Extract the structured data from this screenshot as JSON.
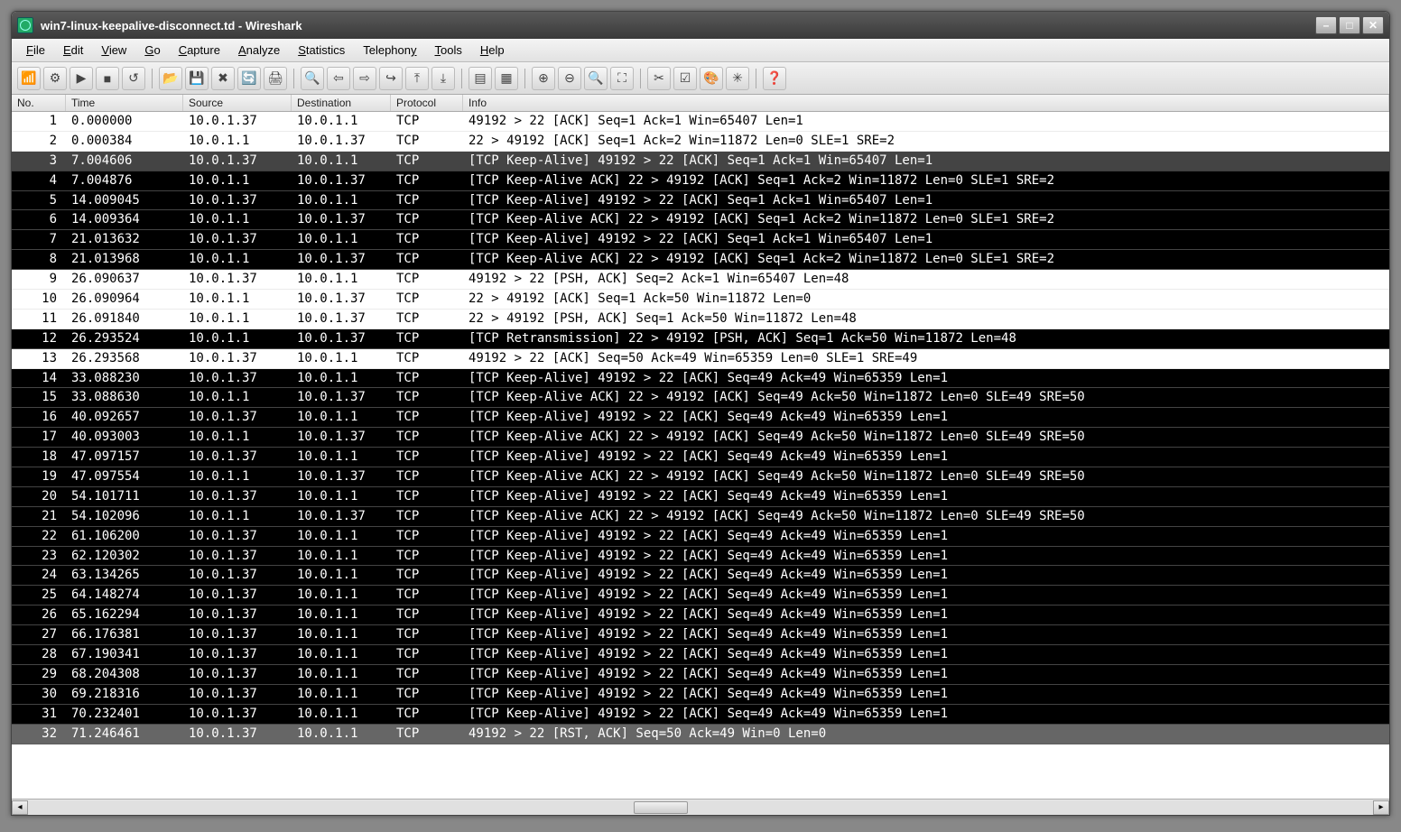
{
  "window": {
    "title": "win7-linux-keepalive-disconnect.td - Wireshark"
  },
  "menu": {
    "file": "File",
    "edit": "Edit",
    "view": "View",
    "go": "Go",
    "capture": "Capture",
    "analyze": "Analyze",
    "statistics": "Statistics",
    "telephony": "Telephony",
    "tools": "Tools",
    "help": "Help"
  },
  "columns": {
    "no": "No.",
    "time": "Time",
    "source": "Source",
    "destination": "Destination",
    "protocol": "Protocol",
    "info": "Info"
  },
  "packets": [
    {
      "no": "1",
      "time": "0.000000",
      "src": "10.0.1.37",
      "dst": "10.0.1.1",
      "proto": "TCP",
      "info": "49192 > 22 [ACK] Seq=1 Ack=1 Win=65407 Len=1",
      "style": "normal"
    },
    {
      "no": "2",
      "time": "0.000384",
      "src": "10.0.1.1",
      "dst": "10.0.1.37",
      "proto": "TCP",
      "info": "22 > 49192 [ACK] Seq=1 Ack=2 Win=11872 Len=0 SLE=1 SRE=2",
      "style": "normal"
    },
    {
      "no": "3",
      "time": "7.004606",
      "src": "10.0.1.37",
      "dst": "10.0.1.1",
      "proto": "TCP",
      "info": "[TCP Keep-Alive] 49192 > 22 [ACK] Seq=1 Ack=1 Win=65407 Len=1",
      "style": "selected"
    },
    {
      "no": "4",
      "time": "7.004876",
      "src": "10.0.1.1",
      "dst": "10.0.1.37",
      "proto": "TCP",
      "info": "[TCP Keep-Alive ACK] 22 > 49192 [ACK] Seq=1 Ack=2 Win=11872 Len=0 SLE=1 SRE=2",
      "style": "dark"
    },
    {
      "no": "5",
      "time": "14.009045",
      "src": "10.0.1.37",
      "dst": "10.0.1.1",
      "proto": "TCP",
      "info": "[TCP Keep-Alive] 49192 > 22 [ACK] Seq=1 Ack=1 Win=65407 Len=1",
      "style": "dark"
    },
    {
      "no": "6",
      "time": "14.009364",
      "src": "10.0.1.1",
      "dst": "10.0.1.37",
      "proto": "TCP",
      "info": "[TCP Keep-Alive ACK] 22 > 49192 [ACK] Seq=1 Ack=2 Win=11872 Len=0 SLE=1 SRE=2",
      "style": "dark"
    },
    {
      "no": "7",
      "time": "21.013632",
      "src": "10.0.1.37",
      "dst": "10.0.1.1",
      "proto": "TCP",
      "info": "[TCP Keep-Alive] 49192 > 22 [ACK] Seq=1 Ack=1 Win=65407 Len=1",
      "style": "dark"
    },
    {
      "no": "8",
      "time": "21.013968",
      "src": "10.0.1.1",
      "dst": "10.0.1.37",
      "proto": "TCP",
      "info": "[TCP Keep-Alive ACK] 22 > 49192 [ACK] Seq=1 Ack=2 Win=11872 Len=0 SLE=1 SRE=2",
      "style": "dark"
    },
    {
      "no": "9",
      "time": "26.090637",
      "src": "10.0.1.37",
      "dst": "10.0.1.1",
      "proto": "TCP",
      "info": "49192 > 22 [PSH, ACK] Seq=2 Ack=1 Win=65407 Len=48",
      "style": "normal"
    },
    {
      "no": "10",
      "time": "26.090964",
      "src": "10.0.1.1",
      "dst": "10.0.1.37",
      "proto": "TCP",
      "info": "22 > 49192 [ACK] Seq=1 Ack=50 Win=11872 Len=0",
      "style": "normal"
    },
    {
      "no": "11",
      "time": "26.091840",
      "src": "10.0.1.1",
      "dst": "10.0.1.37",
      "proto": "TCP",
      "info": "22 > 49192 [PSH, ACK] Seq=1 Ack=50 Win=11872 Len=48",
      "style": "normal"
    },
    {
      "no": "12",
      "time": "26.293524",
      "src": "10.0.1.1",
      "dst": "10.0.1.37",
      "proto": "TCP",
      "info": "[TCP Retransmission] 22 > 49192 [PSH, ACK] Seq=1 Ack=50 Win=11872 Len=48",
      "style": "dark"
    },
    {
      "no": "13",
      "time": "26.293568",
      "src": "10.0.1.37",
      "dst": "10.0.1.1",
      "proto": "TCP",
      "info": "49192 > 22 [ACK] Seq=50 Ack=49 Win=65359 Len=0 SLE=1 SRE=49",
      "style": "normal"
    },
    {
      "no": "14",
      "time": "33.088230",
      "src": "10.0.1.37",
      "dst": "10.0.1.1",
      "proto": "TCP",
      "info": "[TCP Keep-Alive] 49192 > 22 [ACK] Seq=49 Ack=49 Win=65359 Len=1",
      "style": "dark"
    },
    {
      "no": "15",
      "time": "33.088630",
      "src": "10.0.1.1",
      "dst": "10.0.1.37",
      "proto": "TCP",
      "info": "[TCP Keep-Alive ACK] 22 > 49192 [ACK] Seq=49 Ack=50 Win=11872 Len=0 SLE=49 SRE=50",
      "style": "dark"
    },
    {
      "no": "16",
      "time": "40.092657",
      "src": "10.0.1.37",
      "dst": "10.0.1.1",
      "proto": "TCP",
      "info": "[TCP Keep-Alive] 49192 > 22 [ACK] Seq=49 Ack=49 Win=65359 Len=1",
      "style": "dark"
    },
    {
      "no": "17",
      "time": "40.093003",
      "src": "10.0.1.1",
      "dst": "10.0.1.37",
      "proto": "TCP",
      "info": "[TCP Keep-Alive ACK] 22 > 49192 [ACK] Seq=49 Ack=50 Win=11872 Len=0 SLE=49 SRE=50",
      "style": "dark"
    },
    {
      "no": "18",
      "time": "47.097157",
      "src": "10.0.1.37",
      "dst": "10.0.1.1",
      "proto": "TCP",
      "info": "[TCP Keep-Alive] 49192 > 22 [ACK] Seq=49 Ack=49 Win=65359 Len=1",
      "style": "dark"
    },
    {
      "no": "19",
      "time": "47.097554",
      "src": "10.0.1.1",
      "dst": "10.0.1.37",
      "proto": "TCP",
      "info": "[TCP Keep-Alive ACK] 22 > 49192 [ACK] Seq=49 Ack=50 Win=11872 Len=0 SLE=49 SRE=50",
      "style": "dark"
    },
    {
      "no": "20",
      "time": "54.101711",
      "src": "10.0.1.37",
      "dst": "10.0.1.1",
      "proto": "TCP",
      "info": "[TCP Keep-Alive] 49192 > 22 [ACK] Seq=49 Ack=49 Win=65359 Len=1",
      "style": "dark"
    },
    {
      "no": "21",
      "time": "54.102096",
      "src": "10.0.1.1",
      "dst": "10.0.1.37",
      "proto": "TCP",
      "info": "[TCP Keep-Alive ACK] 22 > 49192 [ACK] Seq=49 Ack=50 Win=11872 Len=0 SLE=49 SRE=50",
      "style": "dark"
    },
    {
      "no": "22",
      "time": "61.106200",
      "src": "10.0.1.37",
      "dst": "10.0.1.1",
      "proto": "TCP",
      "info": "[TCP Keep-Alive] 49192 > 22 [ACK] Seq=49 Ack=49 Win=65359 Len=1",
      "style": "dark"
    },
    {
      "no": "23",
      "time": "62.120302",
      "src": "10.0.1.37",
      "dst": "10.0.1.1",
      "proto": "TCP",
      "info": "[TCP Keep-Alive] 49192 > 22 [ACK] Seq=49 Ack=49 Win=65359 Len=1",
      "style": "dark"
    },
    {
      "no": "24",
      "time": "63.134265",
      "src": "10.0.1.37",
      "dst": "10.0.1.1",
      "proto": "TCP",
      "info": "[TCP Keep-Alive] 49192 > 22 [ACK] Seq=49 Ack=49 Win=65359 Len=1",
      "style": "dark"
    },
    {
      "no": "25",
      "time": "64.148274",
      "src": "10.0.1.37",
      "dst": "10.0.1.1",
      "proto": "TCP",
      "info": "[TCP Keep-Alive] 49192 > 22 [ACK] Seq=49 Ack=49 Win=65359 Len=1",
      "style": "dark"
    },
    {
      "no": "26",
      "time": "65.162294",
      "src": "10.0.1.37",
      "dst": "10.0.1.1",
      "proto": "TCP",
      "info": "[TCP Keep-Alive] 49192 > 22 [ACK] Seq=49 Ack=49 Win=65359 Len=1",
      "style": "dark"
    },
    {
      "no": "27",
      "time": "66.176381",
      "src": "10.0.1.37",
      "dst": "10.0.1.1",
      "proto": "TCP",
      "info": "[TCP Keep-Alive] 49192 > 22 [ACK] Seq=49 Ack=49 Win=65359 Len=1",
      "style": "dark"
    },
    {
      "no": "28",
      "time": "67.190341",
      "src": "10.0.1.37",
      "dst": "10.0.1.1",
      "proto": "TCP",
      "info": "[TCP Keep-Alive] 49192 > 22 [ACK] Seq=49 Ack=49 Win=65359 Len=1",
      "style": "dark"
    },
    {
      "no": "29",
      "time": "68.204308",
      "src": "10.0.1.37",
      "dst": "10.0.1.1",
      "proto": "TCP",
      "info": "[TCP Keep-Alive] 49192 > 22 [ACK] Seq=49 Ack=49 Win=65359 Len=1",
      "style": "dark"
    },
    {
      "no": "30",
      "time": "69.218316",
      "src": "10.0.1.37",
      "dst": "10.0.1.1",
      "proto": "TCP",
      "info": "[TCP Keep-Alive] 49192 > 22 [ACK] Seq=49 Ack=49 Win=65359 Len=1",
      "style": "dark"
    },
    {
      "no": "31",
      "time": "70.232401",
      "src": "10.0.1.37",
      "dst": "10.0.1.1",
      "proto": "TCP",
      "info": "[TCP Keep-Alive] 49192 > 22 [ACK] Seq=49 Ack=49 Win=65359 Len=1",
      "style": "dark"
    },
    {
      "no": "32",
      "time": "71.246461",
      "src": "10.0.1.37",
      "dst": "10.0.1.1",
      "proto": "TCP",
      "info": "49192 > 22 [RST, ACK] Seq=50 Ack=49 Win=0 Len=0",
      "style": "gray"
    }
  ],
  "toolbar_icons": [
    {
      "name": "interfaces-icon",
      "glyph": "📶"
    },
    {
      "name": "capture-options-icon",
      "glyph": "⚙"
    },
    {
      "name": "start-capture-icon",
      "glyph": "▶"
    },
    {
      "name": "stop-capture-icon",
      "glyph": "■"
    },
    {
      "name": "restart-capture-icon",
      "glyph": "↺"
    },
    {
      "sep": true
    },
    {
      "name": "open-file-icon",
      "glyph": "📂"
    },
    {
      "name": "save-file-icon",
      "glyph": "💾"
    },
    {
      "name": "close-file-icon",
      "glyph": "✖"
    },
    {
      "name": "reload-icon",
      "glyph": "🔄"
    },
    {
      "name": "print-icon",
      "glyph": "🖨"
    },
    {
      "sep": true
    },
    {
      "name": "find-icon",
      "glyph": "🔍"
    },
    {
      "name": "go-back-icon",
      "glyph": "⇦"
    },
    {
      "name": "go-forward-icon",
      "glyph": "⇨"
    },
    {
      "name": "go-to-icon",
      "glyph": "↪"
    },
    {
      "name": "go-first-icon",
      "glyph": "⤒"
    },
    {
      "name": "go-last-icon",
      "glyph": "⤓"
    },
    {
      "sep": true
    },
    {
      "name": "colorize-icon",
      "glyph": "▤"
    },
    {
      "name": "auto-scroll-icon",
      "glyph": "▦"
    },
    {
      "sep": true
    },
    {
      "name": "zoom-in-icon",
      "glyph": "⊕"
    },
    {
      "name": "zoom-out-icon",
      "glyph": "⊖"
    },
    {
      "name": "zoom-reset-icon",
      "glyph": "🔍"
    },
    {
      "name": "resize-columns-icon",
      "glyph": "⛶"
    },
    {
      "sep": true
    },
    {
      "name": "capture-filters-icon",
      "glyph": "✂"
    },
    {
      "name": "display-filters-icon",
      "glyph": "☑"
    },
    {
      "name": "coloring-rules-icon",
      "glyph": "🎨"
    },
    {
      "name": "preferences-icon",
      "glyph": "✳"
    },
    {
      "sep": true
    },
    {
      "name": "help-icon",
      "glyph": "❓"
    }
  ]
}
